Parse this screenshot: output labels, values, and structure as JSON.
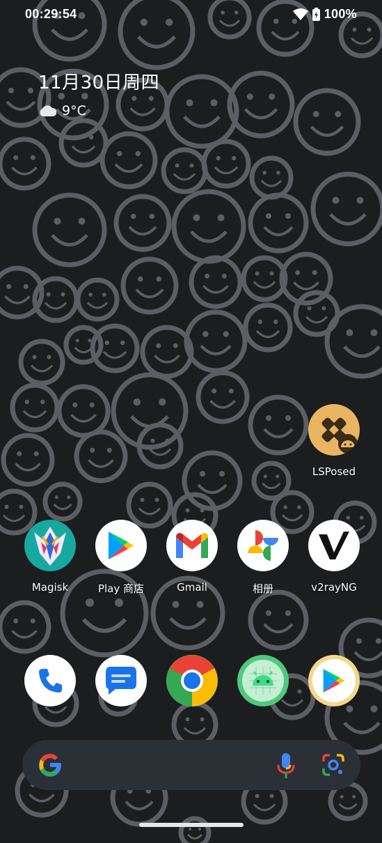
{
  "status_bar": {
    "time": "00:29:54",
    "battery": "100%"
  },
  "date_widget": {
    "date": "11月30日周四",
    "temperature": "9°C",
    "weather_icon": "cloud-icon"
  },
  "apps_row1": [
    {
      "label": "LSPosed",
      "icon": "lsposed-icon"
    }
  ],
  "apps_row2": [
    {
      "label": "Magisk",
      "icon": "magisk-icon"
    },
    {
      "label": "Play 商店",
      "icon": "play-store-icon"
    },
    {
      "label": "Gmail",
      "icon": "gmail-icon"
    },
    {
      "label": "相册",
      "icon": "photos-icon"
    },
    {
      "label": "v2rayNG",
      "icon": "v2rayng-icon"
    }
  ],
  "dock": [
    {
      "icon": "phone-icon"
    },
    {
      "icon": "messages-icon"
    },
    {
      "icon": "chrome-icon"
    },
    {
      "icon": "android-icon"
    },
    {
      "icon": "play-store-icon"
    }
  ],
  "search_bar": {
    "icons": [
      "google-g-icon",
      "microphone-icon",
      "lens-icon"
    ]
  },
  "colors": {
    "background": "#1c1d1f",
    "pattern": "#5b5f63",
    "search_bar": "#2b3036"
  }
}
